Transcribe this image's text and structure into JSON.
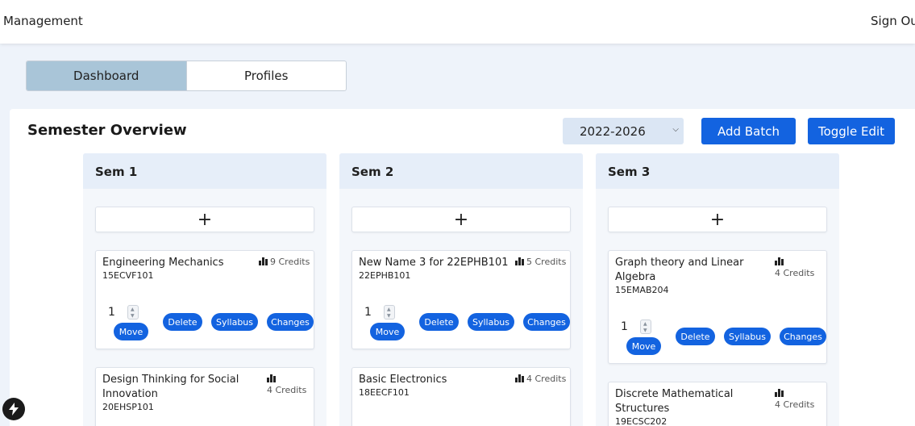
{
  "header": {
    "brand": "Management",
    "sign_out": "Sign Out"
  },
  "tabs": [
    {
      "label": "Dashboard"
    },
    {
      "label": "Profiles"
    }
  ],
  "overview": {
    "title": "Semester Overview",
    "batch": "2022-2026",
    "add_batch": "Add Batch",
    "toggle_edit": "Toggle Edit"
  },
  "semesters": [
    {
      "title": "Sem 1",
      "add": "+",
      "courses": [
        {
          "name": "Engineering Mechanics",
          "code": "15ECVF101",
          "credits": "9 Credits",
          "qty": "1",
          "move": "Move",
          "delete": "Delete",
          "syllabus": "Syllabus",
          "changes": "Changes"
        },
        {
          "name": "Design Thinking for Social Innovation",
          "code": "20EHSP101",
          "credits": "4 Credits"
        }
      ]
    },
    {
      "title": "Sem 2",
      "add": "+",
      "courses": [
        {
          "name": "New Name 3 for 22EPHB101",
          "code": "22EPHB101",
          "credits": "5 Credits",
          "qty": "1",
          "move": "Move",
          "delete": "Delete",
          "syllabus": "Syllabus",
          "changes": "Changes"
        },
        {
          "name": "Basic Electronics",
          "code": "18EECF101",
          "credits": "4 Credits"
        }
      ]
    },
    {
      "title": "Sem 3",
      "add": "+",
      "courses": [
        {
          "name": "Graph theory and Linear Algebra",
          "code": "15EMAB204",
          "credits": "4 Credits",
          "qty": "1",
          "move": "Move",
          "delete": "Delete",
          "syllabus": "Syllabus",
          "changes": "Changes"
        },
        {
          "name": "Discrete Mathematical Structures",
          "code": "19ECSC202",
          "credits": "4 Credits"
        }
      ]
    }
  ],
  "colors": {
    "primary": "#1363e0",
    "active_tab": "#a9c5d8",
    "column_header": "#e6eef9",
    "page_bg": "#eef3fa"
  }
}
